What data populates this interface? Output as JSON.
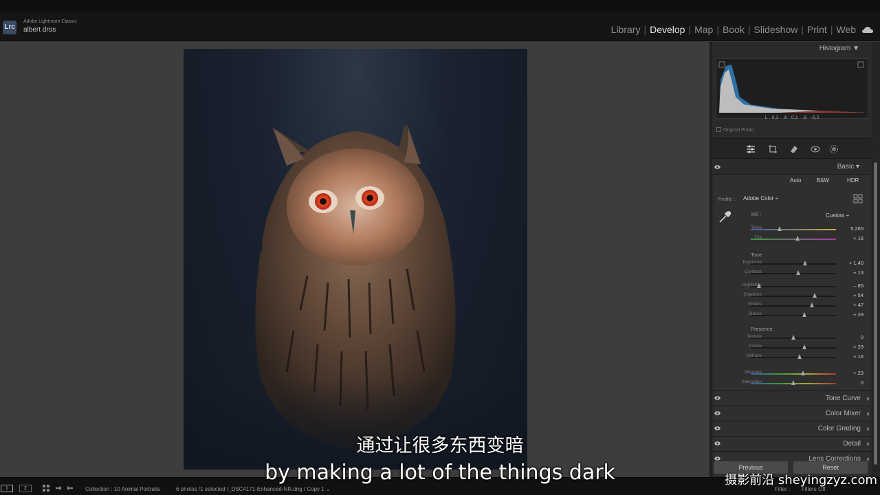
{
  "app": {
    "logo": "Lrc",
    "name": "Adobe Lightroom Classic",
    "user": "albert dros"
  },
  "modules": {
    "items": [
      "Library",
      "Develop",
      "Map",
      "Book",
      "Slideshow",
      "Print",
      "Web"
    ],
    "active": "Develop"
  },
  "histogram": {
    "title": "Histogram",
    "readout": {
      "L_label": "L",
      "L": "6,3",
      "A_label": "A",
      "A": "0,1",
      "B_label": "B",
      "B": "-5,2"
    },
    "original_photo": "Original Photo"
  },
  "basic": {
    "title": "Basic",
    "buttons": [
      "Auto",
      "B&W",
      "HDR"
    ],
    "profile_label": "Profile :",
    "profile_value": "Adobe Color ÷",
    "wb_label": "WB :",
    "wb_value": "Custom ÷",
    "wb_sliders": [
      {
        "label": "Temp",
        "value": "5.265",
        "pos": 0.34
      },
      {
        "label": "Tint",
        "value": "+ 16",
        "pos": 0.55
      }
    ],
    "tone_title": "Tone",
    "tone_sliders": [
      {
        "label": "Exposure",
        "value": "+ 1,40",
        "pos": 0.64
      },
      {
        "label": "Contrast",
        "value": "+ 13",
        "pos": 0.56
      }
    ],
    "tone_sliders2": [
      {
        "label": "Highlights",
        "value": "– 85",
        "pos": 0.1
      },
      {
        "label": "Shadows",
        "value": "+ 54",
        "pos": 0.75
      },
      {
        "label": "Whites",
        "value": "+ 47",
        "pos": 0.72
      },
      {
        "label": "Blacks",
        "value": "+ 29",
        "pos": 0.63
      }
    ],
    "presence_title": "Presence",
    "presence_sliders": [
      {
        "label": "Texture",
        "value": "0",
        "pos": 0.5
      },
      {
        "label": "Clarity",
        "value": "+ 29",
        "pos": 0.63
      },
      {
        "label": "Dehaze",
        "value": "+ 16",
        "pos": 0.57
      }
    ],
    "presence_sliders2": [
      {
        "label": "Vibrance",
        "value": "+ 23",
        "pos": 0.61
      },
      {
        "label": "Saturation",
        "value": "0",
        "pos": 0.5
      }
    ]
  },
  "panels": [
    "Tone Curve",
    "Color Mixer",
    "Color Grading",
    "Detail",
    "Lens Corrections"
  ],
  "footer_buttons": {
    "previous": "Previous",
    "reset": "Reset"
  },
  "filmstrip": {
    "page1": "1",
    "page2": "2",
    "collection": "Collection : 10 Animal Portraits",
    "info": "6 photos /1 selected /_DSC4171-Enhanced-NR.dng / Copy 1 ⌄",
    "filter": "Filter :",
    "filter_value": "Filters Off"
  },
  "subtitles": {
    "cn": "通过让很多东西变暗",
    "en": "by making a lot of the things dark"
  },
  "watermark": "摄影前沿 sheyingzyz.com",
  "colors": {
    "accent": "#e6e6e6",
    "panel": "#2a2a2a",
    "background": "#3d3d3d"
  }
}
